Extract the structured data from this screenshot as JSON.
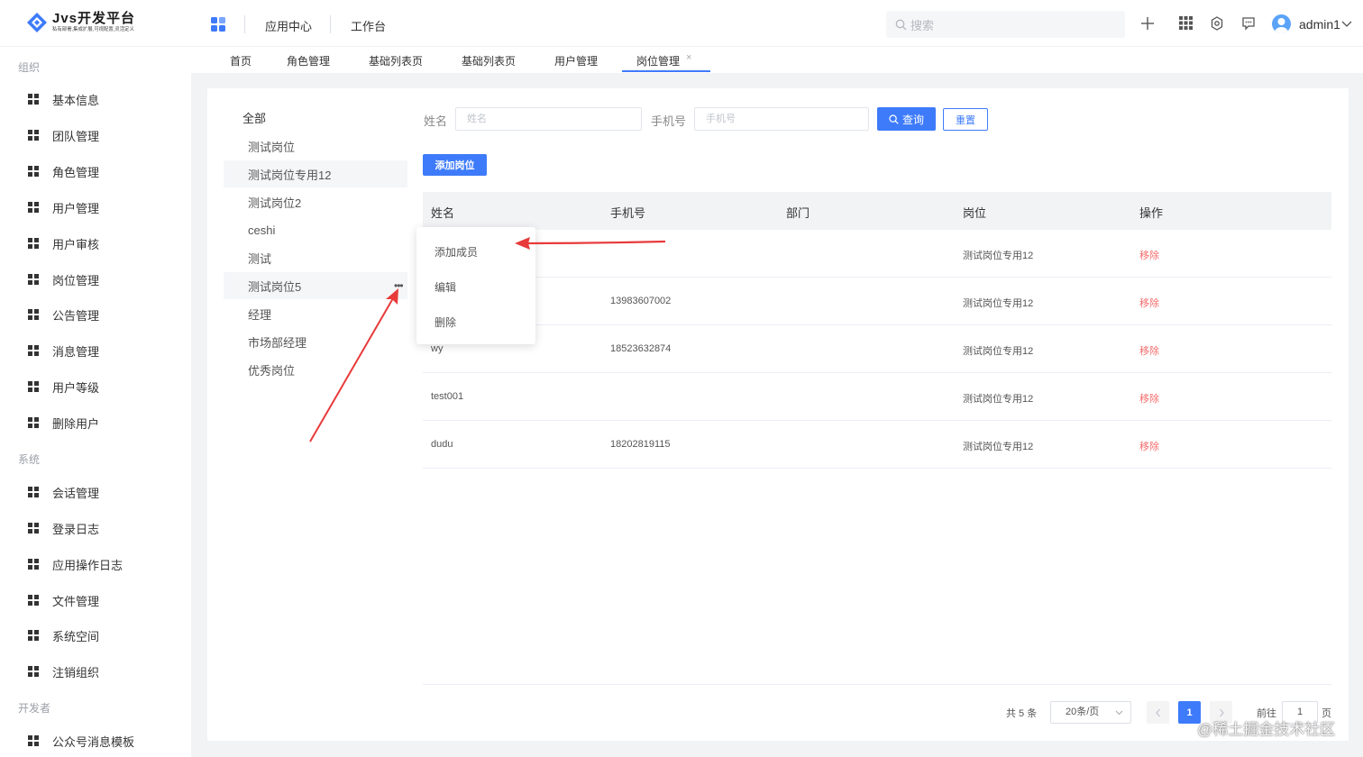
{
  "header": {
    "logo_title": "Jvs开发平台",
    "logo_subtitle": "私有部署,集成扩展,可视配置,灵活定义",
    "nav_app_center": "应用中心",
    "nav_workbench": "工作台",
    "search_placeholder": "搜索",
    "user_name": "admin1"
  },
  "sidebar": {
    "groups": [
      {
        "title": "组织",
        "items": [
          "基本信息",
          "团队管理",
          "角色管理",
          "用户管理",
          "用户审核",
          "岗位管理",
          "公告管理",
          "消息管理",
          "用户等级",
          "删除用户"
        ]
      },
      {
        "title": "系统",
        "items": [
          "会话管理",
          "登录日志",
          "应用操作日志",
          "文件管理",
          "系统空间",
          "注销组织"
        ]
      },
      {
        "title": "开发者",
        "items": [
          "公众号消息模板"
        ]
      }
    ]
  },
  "tabs": {
    "items": [
      "首页",
      "角色管理",
      "基础列表页",
      "基础列表页",
      "用户管理",
      "岗位管理"
    ],
    "close_glyph": "×"
  },
  "positions": {
    "all_label": "全部",
    "items": [
      "测试岗位",
      "测试岗位专用12",
      "测试岗位2",
      "ceshi",
      "测试",
      "测试岗位5",
      "经理",
      "市场部经理",
      "优秀岗位"
    ],
    "more_glyph": "•••"
  },
  "filter": {
    "name_label": "姓名",
    "name_placeholder": "姓名",
    "phone_label": "手机号",
    "phone_placeholder": "手机号",
    "query_button": "查询",
    "reset_button": "重置",
    "add_button": "添加岗位"
  },
  "table": {
    "columns": [
      "姓名",
      "手机号",
      "部门",
      "岗位",
      "操作"
    ],
    "rows": [
      {
        "name": "",
        "phone": "",
        "dept": "",
        "position": "测试岗位专用12",
        "action": "移除"
      },
      {
        "name": "",
        "phone": "13983607002",
        "dept": "",
        "position": "测试岗位专用12",
        "action": "移除"
      },
      {
        "name": "wy",
        "phone": "18523632874",
        "dept": "",
        "position": "测试岗位专用12",
        "action": "移除"
      },
      {
        "name": "test001",
        "phone": "",
        "dept": "",
        "position": "测试岗位专用12",
        "action": "移除"
      },
      {
        "name": "dudu",
        "phone": "18202819115",
        "dept": "",
        "position": "测试岗位专用12",
        "action": "移除"
      }
    ]
  },
  "context_menu": {
    "items": [
      "添加成员",
      "编辑",
      "删除"
    ]
  },
  "pagination": {
    "total_text": "共 5 条",
    "page_size": "20条/页",
    "current_page": "1",
    "goto_label": "前往",
    "goto_value": "1",
    "page_suffix": "页"
  },
  "watermark": "@稀土掘金技术社区",
  "colors": {
    "primary": "#3e7bfa",
    "danger": "#f56c6c",
    "annotation_arrow": "#e83a3a"
  }
}
